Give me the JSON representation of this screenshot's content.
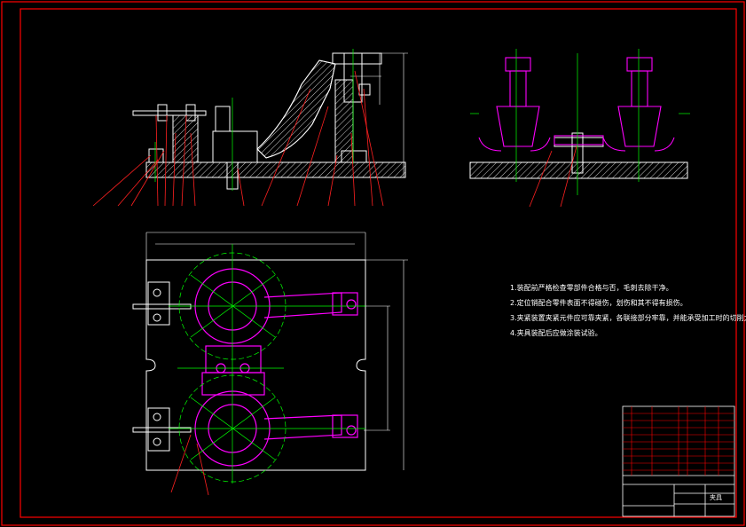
{
  "drawing": {
    "frame_color": "#ff0000",
    "part_color": "#ff00ff",
    "centerline_color": "#00ff00",
    "line_color": "#ffffff",
    "leader_color": "#ff2020",
    "hatch_color": "#ffffff"
  },
  "technical_requirements": [
    "1.装配前严格检查零部件合格与否，毛刺去除干净。",
    "2.定位销配合零件表面不得碰伤，划伤和其不得有损伤。",
    "3.夹紧装置夹紧元件应可靠夹紧，各联接部分牢靠，并能承受加工时的切削力和振动。",
    "4.夹具装配后应做涂装试验。"
  ],
  "title_block": {
    "drawing_title": "夹具"
  }
}
